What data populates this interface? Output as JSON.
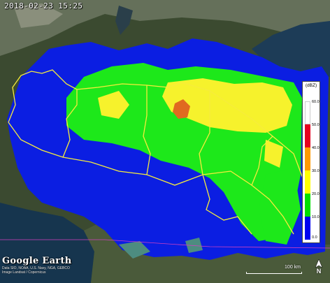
{
  "timestamp": "2018-02-23 15:25",
  "legend": {
    "title": "(dBZ)",
    "ticks": [
      "60.0",
      "50.0",
      "40.0",
      "30.0",
      "20.0",
      "10.0",
      "0.0"
    ],
    "colors": [
      "#ffffff",
      "#e6001f",
      "#ff9a00",
      "#ffff00",
      "#00e000",
      "#0000f0",
      "#4d8c80"
    ]
  },
  "branding": {
    "logo": "Google Earth",
    "attribution": "Image Landsat / Copernicus",
    "credits": "Data SIO, NOAA, U.S. Navy, NGA, GEBCO"
  },
  "scalebar": {
    "label": "100 km"
  },
  "compass": {
    "label": "N"
  },
  "colors": {
    "terrain": "#2f4229",
    "alps": "#6d7560",
    "sea": "#1f3f5c",
    "boundary": "#f6ec3c",
    "radar_blue": "#0a1fe0",
    "radar_green": "#1fe01a",
    "radar_yellow": "#f2f22a",
    "radar_orange": "#e06a20"
  }
}
